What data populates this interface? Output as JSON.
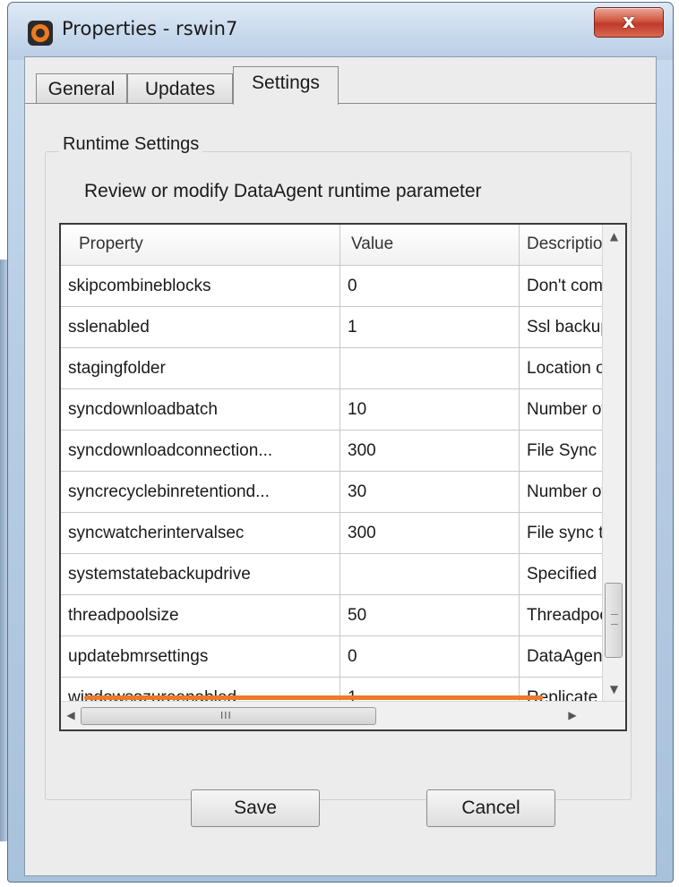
{
  "window": {
    "title": "Properties - rswin7",
    "close_label": "x"
  },
  "tabs": [
    {
      "label": "General"
    },
    {
      "label": "Updates"
    },
    {
      "label": "Settings"
    }
  ],
  "active_tab": "Settings",
  "group": {
    "label": "Runtime Settings",
    "description": "Review or modify DataAgent runtime parameter"
  },
  "table": {
    "columns": [
      "Property",
      "Value",
      "Descriptio"
    ],
    "rows": [
      {
        "property": "skipcombineblocks",
        "value": "0",
        "description": "Don't comb"
      },
      {
        "property": "sslenabled",
        "value": "1",
        "description": "Ssl backup"
      },
      {
        "property": "stagingfolder",
        "value": "",
        "description": "Location of"
      },
      {
        "property": "syncdownloadbatch",
        "value": "10",
        "description": "Number of"
      },
      {
        "property": "syncdownloadconnection...",
        "value": "300",
        "description": "File Sync d"
      },
      {
        "property": "syncrecyclebinretentiond...",
        "value": "30",
        "description": "Number of"
      },
      {
        "property": "syncwatcherintervalsec",
        "value": "300",
        "description": "File sync ti"
      },
      {
        "property": "systemstatebackupdrive",
        "value": "",
        "description": "Specified c"
      },
      {
        "property": "threadpoolsize",
        "value": "50",
        "description": "Threadpoo"
      },
      {
        "property": "updatebmrsettings",
        "value": "0",
        "description": "DataAgent"
      },
      {
        "property": "windowsazureenabled",
        "value": "1",
        "description": "Replicate l"
      }
    ],
    "hscroll_grip": "III"
  },
  "buttons": {
    "save": "Save",
    "cancel": "Cancel"
  },
  "colors": {
    "highlight_underline": "#ea7a2c",
    "close_button": "#c0392b"
  }
}
